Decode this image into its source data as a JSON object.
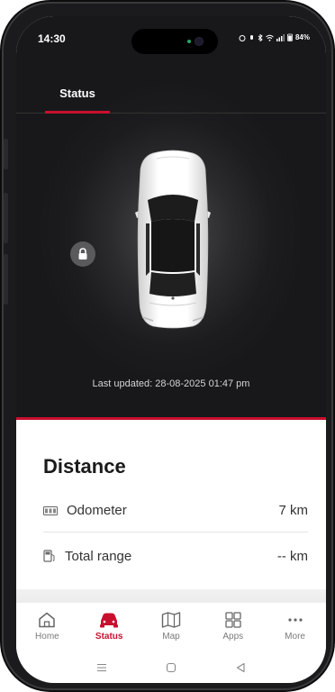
{
  "status_bar": {
    "time": "14:30",
    "battery": "84%"
  },
  "header": {
    "tab_label": "Status"
  },
  "vehicle": {
    "last_updated": "Last updated: 28-08-2025 01:47 pm",
    "lock_icon": "lock-icon"
  },
  "distance": {
    "title": "Distance",
    "odometer_label": "Odometer",
    "odometer_value": "7 km",
    "range_label": "Total range",
    "range_value": "-- km"
  },
  "bottom_nav": {
    "items": [
      {
        "label": "Home",
        "icon": "home-icon"
      },
      {
        "label": "Status",
        "icon": "car-icon"
      },
      {
        "label": "Map",
        "icon": "map-icon"
      },
      {
        "label": "Apps",
        "icon": "grid-icon"
      },
      {
        "label": "More",
        "icon": "more-icon"
      }
    ]
  },
  "colors": {
    "accent": "#c8102e",
    "dark_bg": "#1c1c1e"
  }
}
